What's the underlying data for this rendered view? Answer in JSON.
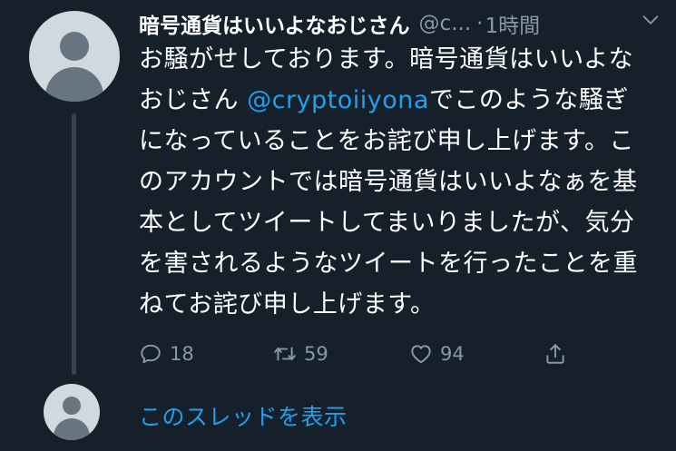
{
  "tweet": {
    "author_name": "暗号通貨はいいよなおじさん",
    "handle": "@c...",
    "separator": "·",
    "time": "1時間",
    "text_before_mention": "お騒がせしております。暗号通貨はいいよなおじさん ",
    "mention": "@cryptoiiyona",
    "text_after_mention": "でこのような騒ぎになっていることをお詫び申し上げます。このアカウントでは暗号通貨はいいよなぁを基本としてツイートしてまいりましたが、気分を害されるようなツイートを行ったことを重ねてお詫び申し上げます。",
    "reply_count": "18",
    "retweet_count": "59",
    "like_count": "94"
  },
  "thread": {
    "show_thread_label": "このスレッドを表示"
  },
  "icons": {
    "avatar": "default-profile-avatar",
    "more": "chevron-down-icon",
    "reply": "reply-icon",
    "retweet": "retweet-icon",
    "like": "heart-icon",
    "share": "share-icon"
  },
  "colors": {
    "background": "#15202b",
    "text": "#ffffff",
    "secondary": "#8899a6",
    "accent": "#1da1f2"
  }
}
